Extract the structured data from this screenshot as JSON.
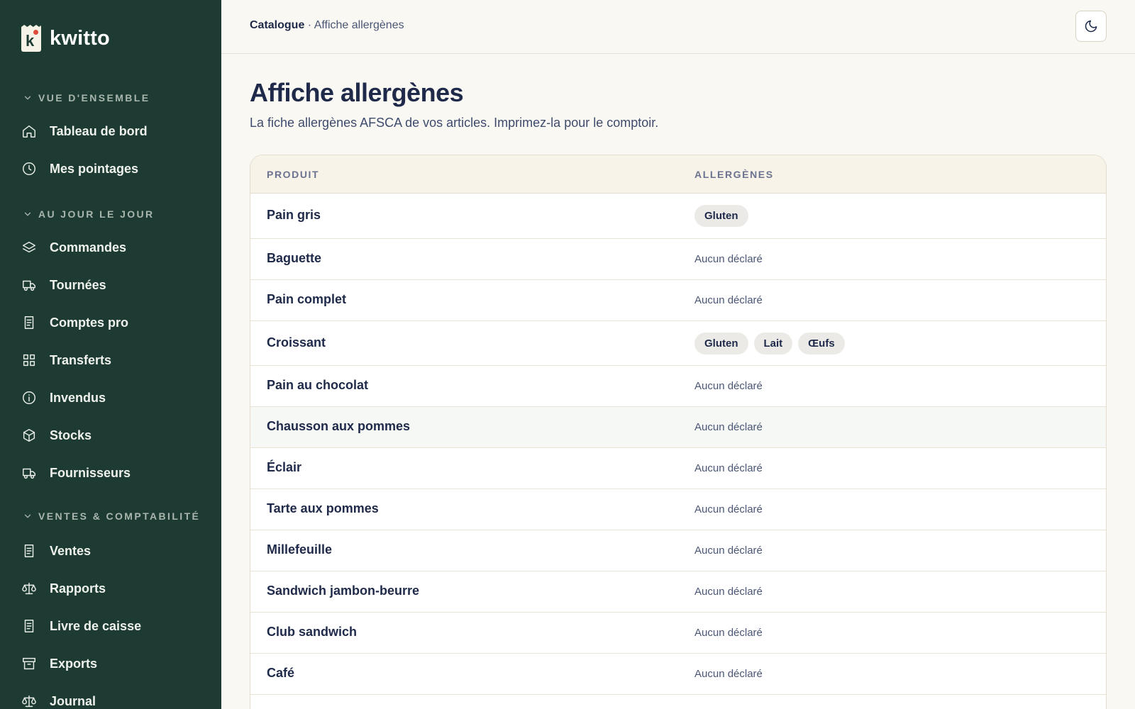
{
  "brand": {
    "name": "kwitto",
    "logo_letter": "k"
  },
  "sidebar": {
    "sections": [
      {
        "label": "Vue d'ensemble",
        "items": [
          {
            "label": "Tableau de bord",
            "icon": "home-icon"
          },
          {
            "label": "Mes pointages",
            "icon": "clock-icon"
          }
        ]
      },
      {
        "label": "Au jour le jour",
        "items": [
          {
            "label": "Commandes",
            "icon": "layers-icon"
          },
          {
            "label": "Tournées",
            "icon": "truck-icon"
          },
          {
            "label": "Comptes pro",
            "icon": "document-icon"
          },
          {
            "label": "Transferts",
            "icon": "grid-icon"
          },
          {
            "label": "Invendus",
            "icon": "info-icon"
          },
          {
            "label": "Stocks",
            "icon": "box-icon"
          },
          {
            "label": "Fournisseurs",
            "icon": "truck-icon"
          }
        ]
      },
      {
        "label": "Ventes & comptabilité",
        "items": [
          {
            "label": "Ventes",
            "icon": "document-icon"
          },
          {
            "label": "Rapports",
            "icon": "scale-icon"
          },
          {
            "label": "Livre de caisse",
            "icon": "document-icon"
          },
          {
            "label": "Exports",
            "icon": "archive-icon"
          },
          {
            "label": "Journal",
            "icon": "scale-icon"
          }
        ]
      }
    ]
  },
  "header": {
    "breadcrumb_parent": "Catalogue",
    "breadcrumb_sep": " · ",
    "breadcrumb_current": "Affiche allergènes",
    "theme_toggle_icon": "moon-icon"
  },
  "page": {
    "title": "Affiche allergènes",
    "subtitle": "La fiche allergènes AFSCA de vos articles. Imprimez-la pour le comptoir."
  },
  "table": {
    "columns": [
      "Produit",
      "Allergènes"
    ],
    "rows": [
      {
        "product": "Pain gris",
        "allergens": [
          "Gluten"
        ]
      },
      {
        "product": "Baguette",
        "allergens": [],
        "none_label": "Aucun déclaré"
      },
      {
        "product": "Pain complet",
        "allergens": [],
        "none_label": "Aucun déclaré"
      },
      {
        "product": "Croissant",
        "allergens": [
          "Gluten",
          "Lait",
          "Œufs"
        ]
      },
      {
        "product": "Pain au chocolat",
        "allergens": [],
        "none_label": "Aucun déclaré"
      },
      {
        "product": "Chausson aux pommes",
        "allergens": [],
        "none_label": "Aucun déclaré",
        "highlighted": true
      },
      {
        "product": "Éclair",
        "allergens": [],
        "none_label": "Aucun déclaré"
      },
      {
        "product": "Tarte aux pommes",
        "allergens": [],
        "none_label": "Aucun déclaré"
      },
      {
        "product": "Millefeuille",
        "allergens": [],
        "none_label": "Aucun déclaré"
      },
      {
        "product": "Sandwich jambon-beurre",
        "allergens": [],
        "none_label": "Aucun déclaré"
      },
      {
        "product": "Club sandwich",
        "allergens": [],
        "none_label": "Aucun déclaré"
      },
      {
        "product": "Café",
        "allergens": [],
        "none_label": "Aucun déclaré"
      }
    ]
  },
  "colors": {
    "sidebar_bg": "#1d3b33",
    "page_bg": "#faf8f2",
    "text_primary": "#1f2a4a",
    "logo_dot": "#e0483a"
  }
}
